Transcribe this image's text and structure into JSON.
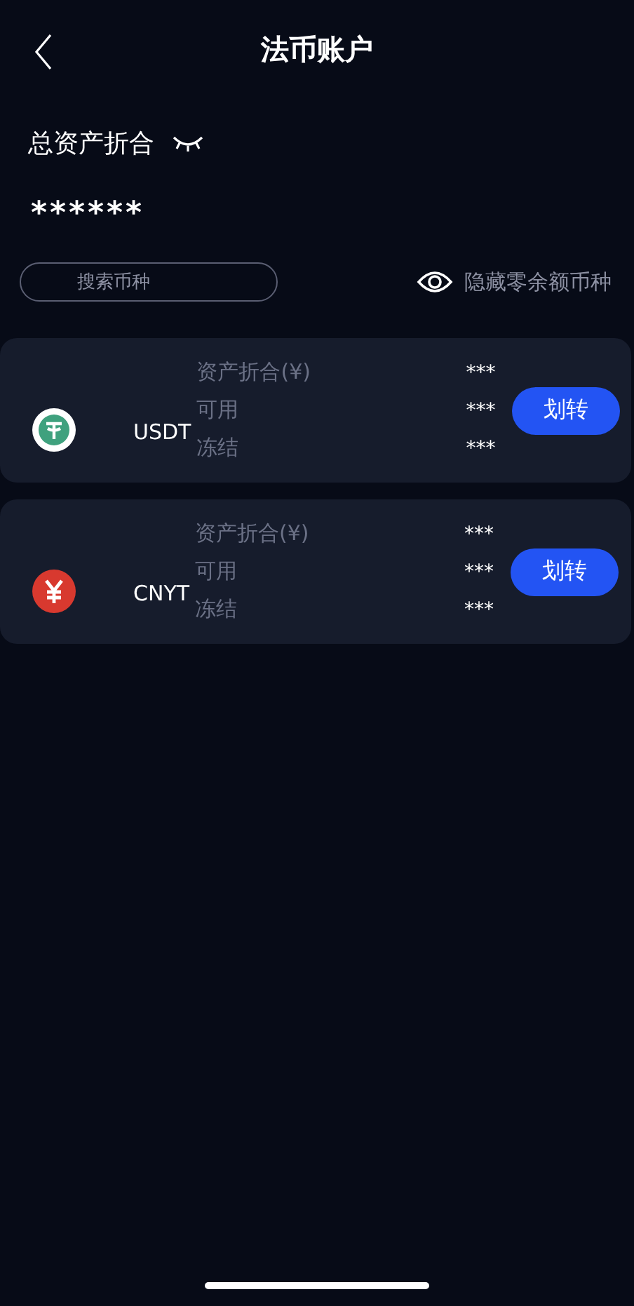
{
  "header": {
    "title": "法币账户"
  },
  "total": {
    "label": "总资产折合",
    "hidden": true,
    "value": "******"
  },
  "search": {
    "placeholder": "搜索币种"
  },
  "hide_zero": {
    "label": "隐藏零余额币种",
    "checked": false
  },
  "coins": [
    {
      "kind": "usdt",
      "name": "USDT",
      "rows": [
        {
          "label": "资产折合(¥)",
          "value": "***"
        },
        {
          "label": "可用",
          "value": "***"
        },
        {
          "label": "冻结",
          "value": "***"
        }
      ],
      "button": "划转"
    },
    {
      "kind": "cnyt",
      "name": "CNYT",
      "rows": [
        {
          "label": "资产折合(¥)",
          "value": "***"
        },
        {
          "label": "可用",
          "value": "***"
        },
        {
          "label": "冻结",
          "value": "***"
        }
      ],
      "button": "划转"
    }
  ]
}
